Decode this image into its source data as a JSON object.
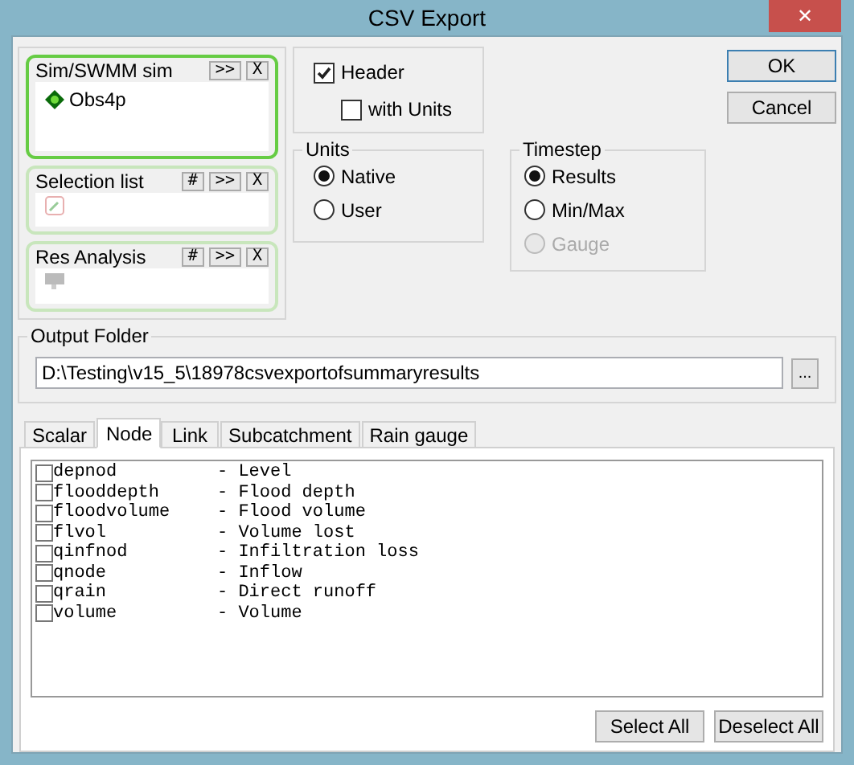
{
  "window": {
    "title": "CSV Export",
    "close": "✕"
  },
  "panels": [
    {
      "title": "Sim/SWMM sim",
      "active": true,
      "buttons": [
        ">>",
        "X"
      ],
      "items": [
        {
          "label": "Obs4p",
          "kind": "sim"
        }
      ]
    },
    {
      "title": "Selection list",
      "active": false,
      "buttons": [
        "#",
        ">>",
        "X"
      ],
      "items": [
        {
          "kind": "selection"
        }
      ]
    },
    {
      "title": "Res Analysis",
      "active": false,
      "buttons": [
        "#",
        ">>",
        "X"
      ],
      "items": [
        {
          "kind": "analysis"
        }
      ]
    }
  ],
  "header": {
    "label": "Header",
    "checked": true
  },
  "with_units": {
    "label": "with Units",
    "checked": false
  },
  "units": {
    "title": "Units",
    "options": [
      {
        "label": "Native",
        "selected": true
      },
      {
        "label": "User",
        "selected": false
      }
    ]
  },
  "timestep": {
    "title": "Timestep",
    "options": [
      {
        "label": "Results",
        "selected": true,
        "disabled": false
      },
      {
        "label": "Min/Max",
        "selected": false,
        "disabled": false
      },
      {
        "label": "Gauge",
        "selected": false,
        "disabled": true
      }
    ]
  },
  "buttons": [
    "OK",
    "Cancel"
  ],
  "output_folder": {
    "title": "Output Folder",
    "value": "D:\\Testing\\v15_5\\18978csvexportofsummaryresults",
    "browse": "..."
  },
  "tabs": [
    {
      "label": "Scalar",
      "selected": false
    },
    {
      "label": "Node",
      "selected": true
    },
    {
      "label": "Link",
      "selected": false
    },
    {
      "label": "Subcatchment",
      "selected": false
    },
    {
      "label": "Rain gauge",
      "selected": false
    }
  ],
  "fields": [
    {
      "name": "depnod",
      "description": "- Level",
      "checked": false
    },
    {
      "name": "flooddepth",
      "description": "- Flood depth",
      "checked": false
    },
    {
      "name": "floodvolume",
      "description": "- Flood volume",
      "checked": false
    },
    {
      "name": "flvol",
      "description": "- Volume lost",
      "checked": false
    },
    {
      "name": "qinfnod",
      "description": "- Infiltration loss",
      "checked": false
    },
    {
      "name": "qnode",
      "description": "- Inflow",
      "checked": false
    },
    {
      "name": "qrain",
      "description": "- Direct runoff",
      "checked": false
    },
    {
      "name": "volume",
      "description": "- Volume",
      "checked": false
    }
  ],
  "list_buttons": [
    "Select All",
    "Deselect All"
  ]
}
